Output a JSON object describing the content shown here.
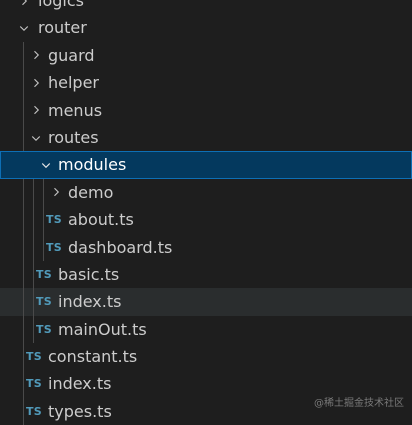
{
  "explorer": {
    "items": [
      {
        "label": "logics",
        "kind": "folder",
        "expanded": false
      },
      {
        "label": "router",
        "kind": "folder",
        "expanded": true
      },
      {
        "label": "guard",
        "kind": "folder",
        "expanded": false
      },
      {
        "label": "helper",
        "kind": "folder",
        "expanded": false
      },
      {
        "label": "menus",
        "kind": "folder",
        "expanded": false
      },
      {
        "label": "routes",
        "kind": "folder",
        "expanded": true
      },
      {
        "label": "modules",
        "kind": "folder",
        "expanded": true,
        "selected": true
      },
      {
        "label": "demo",
        "kind": "folder",
        "expanded": false
      },
      {
        "label": "about.ts",
        "kind": "file",
        "icon": "TS"
      },
      {
        "label": "dashboard.ts",
        "kind": "file",
        "icon": "TS"
      },
      {
        "label": "basic.ts",
        "kind": "file",
        "icon": "TS"
      },
      {
        "label": "index.ts",
        "kind": "file",
        "icon": "TS",
        "hovered": true
      },
      {
        "label": "mainOut.ts",
        "kind": "file",
        "icon": "TS"
      },
      {
        "label": "constant.ts",
        "kind": "file",
        "icon": "TS"
      },
      {
        "label": "index.ts",
        "kind": "file",
        "icon": "TS"
      },
      {
        "label": "types.ts",
        "kind": "file",
        "icon": "TS"
      }
    ]
  },
  "watermark": "@稀土掘金技术社区",
  "colors": {
    "background": "#1e1e1e",
    "selection": "#04395e",
    "selection_border": "#0d6fb5",
    "hover": "#2a2d2e",
    "ts_icon": "#519aba",
    "text": "#cccccc"
  }
}
